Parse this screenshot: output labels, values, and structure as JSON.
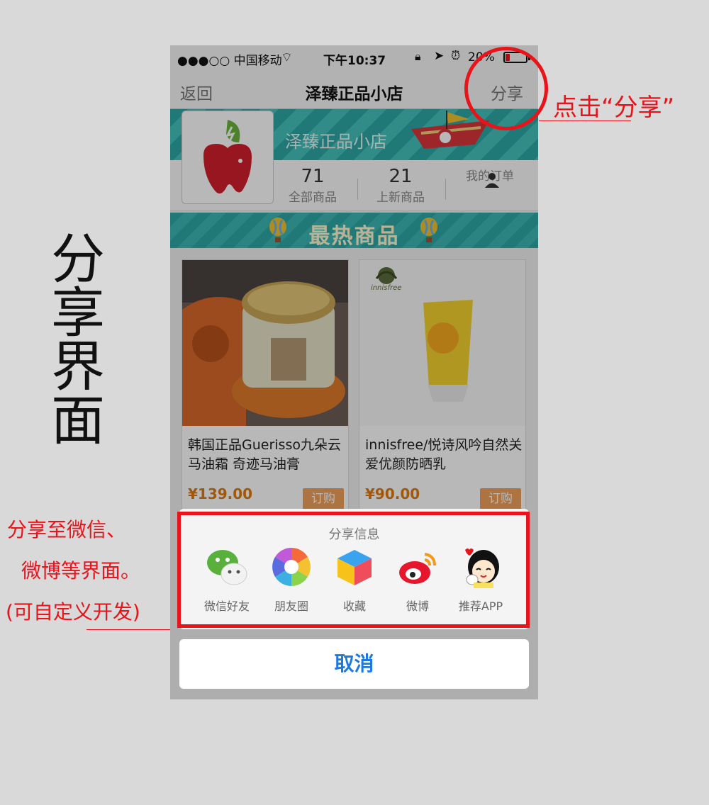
{
  "annotations": {
    "side_title": [
      "分",
      "享",
      "界",
      "面"
    ],
    "click_share_note": "点击“分享”",
    "share_to_note_lines": [
      "分享至微信、",
      "微博等界面。",
      "(可自定义开发)"
    ],
    "accent_color": "#e8141a"
  },
  "status_bar": {
    "carrier": "●●●○○ 中国移动",
    "time": "下午10:37",
    "battery": "20%",
    "battery_level": 0.2
  },
  "nav": {
    "back_label": "返回",
    "title": "泽臻正品小店",
    "share_label": "分享"
  },
  "shop": {
    "banner_name": "泽臻正品小店",
    "stats": [
      {
        "num": "71",
        "label": "全部商品"
      },
      {
        "num": "21",
        "label": "上新商品"
      },
      {
        "num": "",
        "label": "我的订单"
      }
    ]
  },
  "hot_section": {
    "title": "最热商品"
  },
  "products": [
    {
      "name": "韩国正品Guerisso九朵云马油霜 奇迹马油膏",
      "price": "¥139.00",
      "buy_label": "订购"
    },
    {
      "name": "innisfree/悦诗风吟自然关爱优颜防晒乳",
      "price": "¥90.00",
      "buy_label": "订购",
      "brand": "innisfree"
    }
  ],
  "share_sheet": {
    "title": "分享信息",
    "items": [
      {
        "label": "微信好友",
        "icon": "wechat-icon"
      },
      {
        "label": "朋友圈",
        "icon": "moments-icon"
      },
      {
        "label": "收藏",
        "icon": "favorites-icon"
      },
      {
        "label": "微博",
        "icon": "weibo-icon"
      },
      {
        "label": "推荐APP",
        "icon": "recommend-app-icon"
      }
    ],
    "cancel_label": "取消"
  }
}
